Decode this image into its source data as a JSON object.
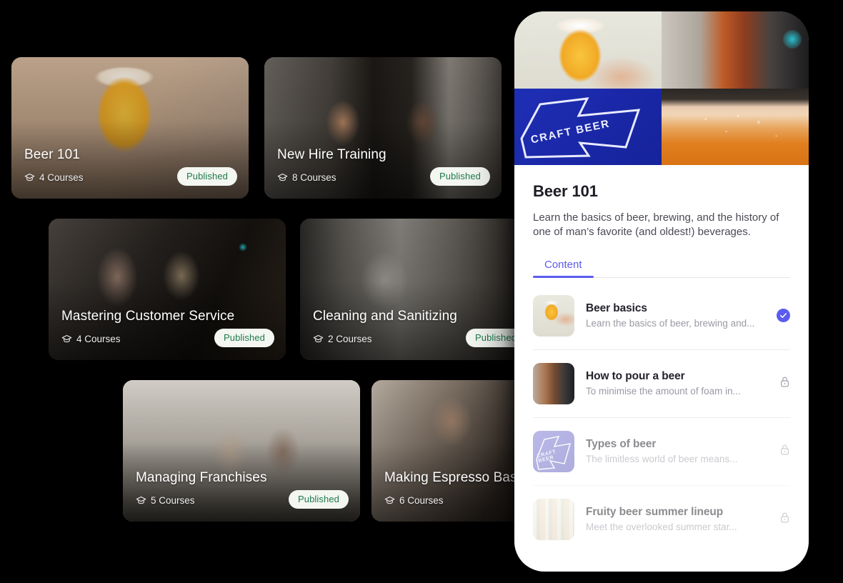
{
  "courses": [
    {
      "title": "Beer 101",
      "courses_label": "4 Courses",
      "status": "Published",
      "photo_class": "ph-beer101",
      "id": "beer101"
    },
    {
      "title": "New Hire Training",
      "courses_label": "8 Courses",
      "status": "Published",
      "photo_class": "ph-newhire",
      "id": "newhire"
    },
    {
      "title": "Mastering Customer Service",
      "courses_label": "4 Courses",
      "status": "Published",
      "photo_class": "ph-customerservice",
      "id": "customerservice"
    },
    {
      "title": "Cleaning and Sanitizing",
      "courses_label": "2 Courses",
      "status": "Published",
      "photo_class": "ph-cleaning",
      "id": "cleaning"
    },
    {
      "title": "Managing Franchises",
      "courses_label": "5 Courses",
      "status": "Published",
      "photo_class": "ph-franchises",
      "id": "franchises"
    },
    {
      "title": "Making Espresso Based",
      "courses_label": "6 Courses",
      "status": "",
      "photo_class": "ph-espresso",
      "id": "espresso"
    }
  ],
  "phone": {
    "hero": {
      "sign_text": "CRAFT BEER",
      "quadrants": [
        "beer-glass-photo",
        "beer-taps-photo",
        "craft-beer-sign-photo",
        "beer-foam-photo"
      ]
    },
    "title": "Beer 101",
    "description": "Learn the basics of beer, brewing, and the history of one of man’s favorite (and oldest!) beverages.",
    "tabs": [
      {
        "label": "Content",
        "active": true
      }
    ],
    "content_items": [
      {
        "title": "Beer basics",
        "subtitle": "Learn the basics of beer, brewing and...",
        "state": "completed",
        "thumb_class": "th-beerbasics",
        "faded": false
      },
      {
        "title": "How to pour a beer",
        "subtitle": "To minimise the amount of foam in...",
        "state": "locked",
        "thumb_class": "th-pour",
        "faded": false
      },
      {
        "title": "Types of beer",
        "subtitle": "The limitless world of beer means...",
        "state": "locked",
        "thumb_class": "th-types",
        "faded": true,
        "thumb_text": "CRAFT BEER"
      },
      {
        "title": "Fruity beer summer lineup",
        "subtitle": "Meet the overlooked summer star...",
        "state": "locked",
        "thumb_class": "th-cans",
        "faded": true
      }
    ]
  },
  "colors": {
    "accent_purple": "#5b5bef",
    "published_green": "#1f7a4d",
    "published_bg": "#f3f6f1",
    "page_background": "#000000",
    "phone_background": "#ffffff"
  },
  "icons": {
    "graduation_cap": "graduation-cap-icon",
    "check": "check-circle-icon",
    "lock": "lock-icon"
  }
}
